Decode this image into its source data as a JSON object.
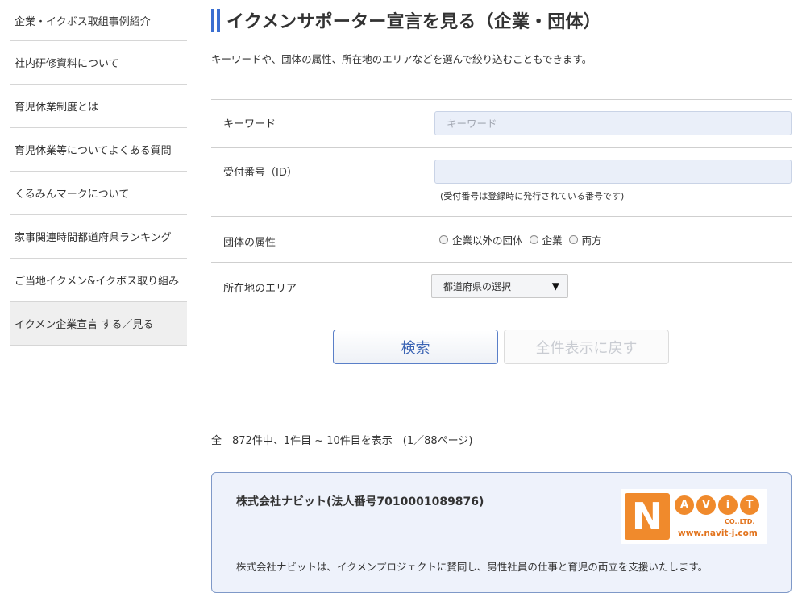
{
  "sidebar": {
    "items": [
      {
        "label": "企業・イクボス取組事例紹介"
      },
      {
        "label": "社内研修資料について"
      },
      {
        "label": "育児休業制度とは"
      },
      {
        "label": "育児休業等についてよくある質問"
      },
      {
        "label": "くるみんマークについて"
      },
      {
        "label": "家事関連時間都道府県ランキング"
      },
      {
        "label": "ご当地イクメン&イクボス取り組み"
      },
      {
        "label": "イクメン企業宣言 する／見る",
        "active": true
      }
    ]
  },
  "main": {
    "title": "イクメンサポーター宣言を見る（企業・団体）",
    "lead": "キーワードや、団体の属性、所在地のエリアなどを選んで絞り込むこともできます。",
    "form": {
      "keyword": {
        "label": "キーワード",
        "placeholder": "キーワード",
        "value": ""
      },
      "reception_id": {
        "label": "受付番号（ID）",
        "value": "",
        "hint": "(受付番号は登録時に発行されている番号です)"
      },
      "attribute": {
        "label": "団体の属性",
        "options": [
          "企業以外の団体",
          "企業",
          "両方"
        ]
      },
      "area": {
        "label": "所在地のエリア",
        "selected": "都道府県の選択",
        "caret_icon": "triangle-down"
      }
    },
    "buttons": {
      "search": "検索",
      "reset": "全件表示に戻す"
    },
    "result_count": "全　872件中、1件目 ~ 10件目を表示　(1／88ページ)",
    "card": {
      "name": "株式会社ナビット(法人番号7010001089876)",
      "description": "株式会社ナビットは、イクメンプロジェクトに賛同し、男性社員の仕事と育児の両立を支援いたします。",
      "logo": {
        "letter": "N",
        "word": [
          "A",
          "V",
          "i",
          "T"
        ],
        "company": "CO.,LTD.",
        "url": "www.navit-j.com"
      }
    }
  },
  "colors": {
    "accent": "#3b6fd1",
    "card_bg": "#eef2fb",
    "logo_orange": "#f08a2c"
  }
}
